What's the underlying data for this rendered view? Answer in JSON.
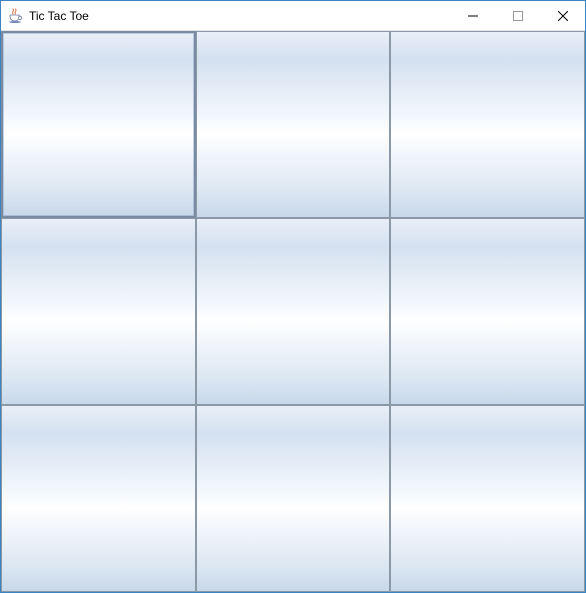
{
  "window": {
    "title": "Tic Tac Toe",
    "app_icon": "java-cup-icon"
  },
  "controls": {
    "minimize": "Minimize",
    "maximize": "Maximize",
    "close": "Close"
  },
  "board": {
    "cells": [
      "",
      "",
      "",
      "",
      "",
      "",
      "",
      "",
      ""
    ]
  }
}
